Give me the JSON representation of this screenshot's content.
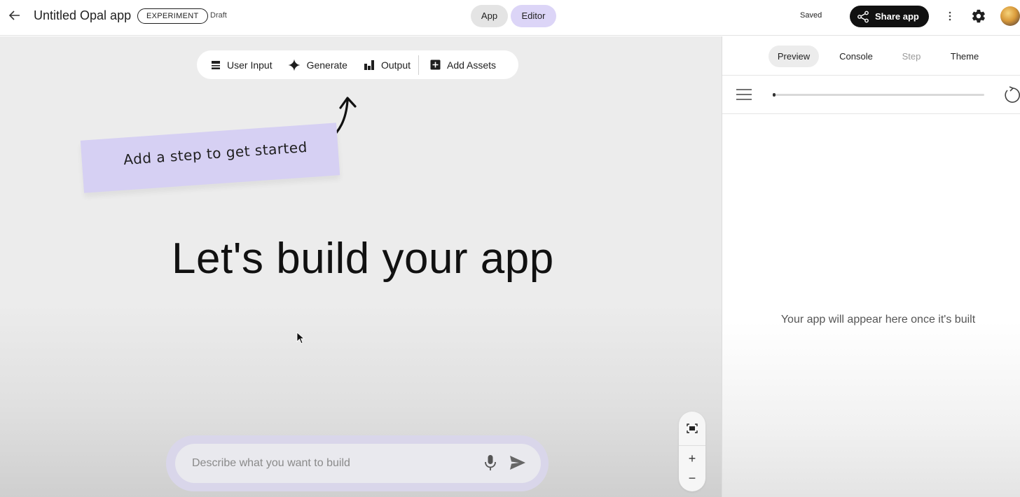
{
  "header": {
    "title": "Untitled Opal app",
    "badge": "EXPERIMENT",
    "status": "Draft",
    "modes": [
      "App",
      "Editor"
    ],
    "active_mode": "Editor",
    "save_status": "Saved",
    "share_label": "Share app"
  },
  "toolbar": {
    "user_input": "User Input",
    "generate": "Generate",
    "output": "Output",
    "add_assets": "Add Assets"
  },
  "canvas": {
    "sticky_note": "Add a step to get started",
    "headline": "Let's build your app",
    "prompt_placeholder": "Describe what you want to build"
  },
  "zoom": {
    "zoom_in": "+",
    "zoom_out": "−"
  },
  "preview_panel": {
    "tabs": [
      "Preview",
      "Console",
      "Step",
      "Theme"
    ],
    "active_tab": "Preview",
    "progress_fraction": 0.01,
    "empty_message": "Your app will appear here once it's built"
  },
  "colors": {
    "accent": "#dcd5f7",
    "sticky": "#d6d0f3",
    "share_button": "#111111"
  }
}
